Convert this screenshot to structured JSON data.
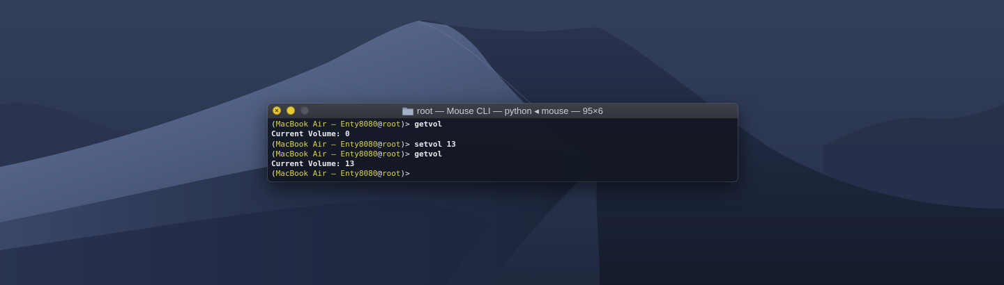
{
  "colors": {
    "sky_top": "#3a4763",
    "sky_bottom": "#1c2436",
    "dune_light": "#5b6a8c",
    "dune_dark": "#1e2740",
    "terminal_bg": "#141824",
    "prompt_yellow": "#d8d24a",
    "text": "#e8e9ec",
    "traffic_yellow": "#e7c938"
  },
  "window": {
    "title": "root — Mouse CLI — python ◂ mouse — 95×6",
    "folder_icon": "folder-icon"
  },
  "prompt": {
    "host": "MacBook Air – Enty8080",
    "user": "root",
    "open": "(",
    "at": "@",
    "close": ")>"
  },
  "terminal_lines": [
    {
      "type": "command",
      "command": " getvol"
    },
    {
      "type": "output",
      "text": "Current Volume: 0"
    },
    {
      "type": "command",
      "command": " setvol 13"
    },
    {
      "type": "command",
      "command": " getvol"
    },
    {
      "type": "output",
      "text": "Current Volume: 13"
    },
    {
      "type": "command",
      "command": ""
    }
  ]
}
